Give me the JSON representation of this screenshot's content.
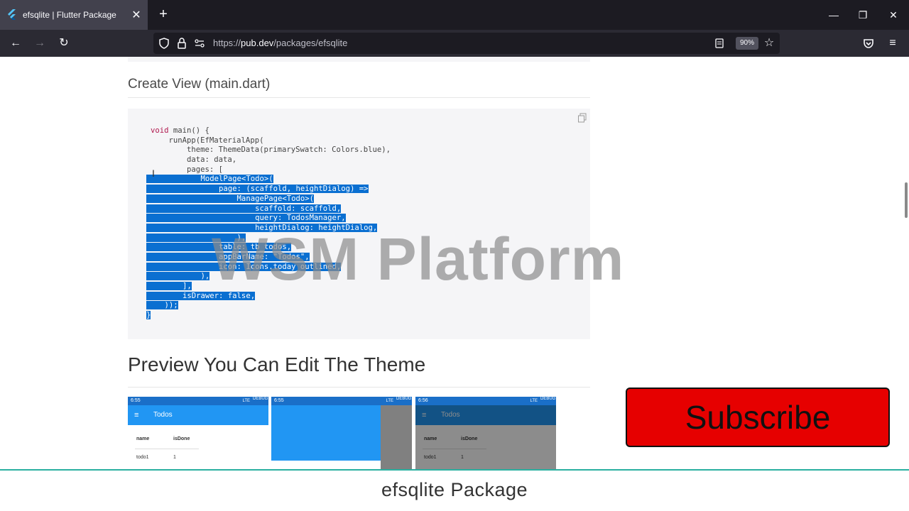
{
  "browser": {
    "tab_title": "efsqlite | Flutter Package",
    "tab_close": "✕",
    "new_tab": "+",
    "url_scheme": "https://",
    "url_host": "pub.dev",
    "url_path": "/packages/efsqlite",
    "zoom": "90%",
    "window_minimize": "—",
    "window_restore": "❐",
    "window_close": "✕"
  },
  "page": {
    "section_heading": "Create View (main.dart)",
    "code_lines": [
      "void main() {",
      "    runApp(EfMaterialApp(",
      "        theme: ThemeData(primarySwatch: Colors.blue),",
      "        data: data,",
      "        pages: [",
      "            ModelPage<Todo>(",
      "                page: (scaffold, heightDialog) =>",
      "                    ManagePage<Todo>(",
      "                        scaffold: scaffold,",
      "                        query: TodosManager,",
      "                        heightDialog: heightDialog,",
      "                    ),",
      "                table: tb_todos,",
      "                appBarName: \"Todos\",",
      "                icon: Icons.today_outlined,",
      "            ),",
      "        ],",
      "        isDrawer: false,",
      "    ));",
      "}"
    ],
    "preview_heading": "Preview You Can Edit The Theme",
    "preview_screens": [
      {
        "time": "6:55",
        "title": "Todos",
        "col_name": "name",
        "col_done": "isDone",
        "row_name": "todo1",
        "row_done": "1"
      },
      {
        "time": "6:55"
      },
      {
        "time": "6:56",
        "title": "Todos",
        "col_name": "name",
        "col_done": "isDone",
        "row_name": "todo1",
        "row_done": "1"
      }
    ],
    "status_right": "LTE",
    "debug_banner": "DEBUG"
  },
  "overlay": {
    "watermark": "WSM Platform",
    "subscribe_label": "Subscribe",
    "footer_title": "efsqlite Package"
  },
  "colors": {
    "selection": "#0a6fd1",
    "subscribe_bg": "#e60000",
    "footer_accent": "#2ab0a0"
  }
}
